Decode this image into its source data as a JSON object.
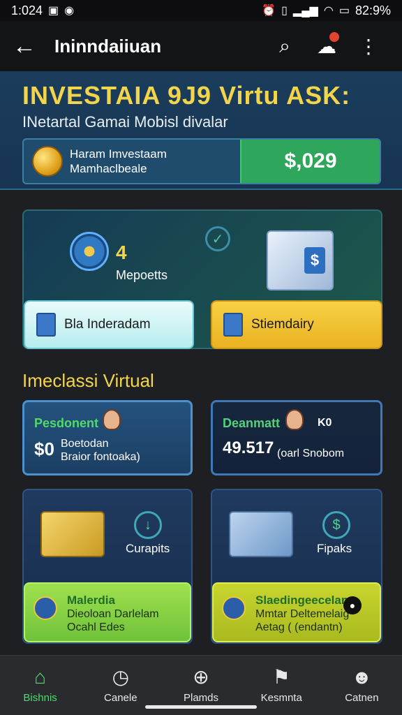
{
  "status": {
    "time": "1:024",
    "battery": "82:9%"
  },
  "app_bar": {
    "title": "Ininndaiiuan"
  },
  "hero": {
    "title": "INVESTAIA 9J9 Virtu ASK:",
    "subtitle": "INetartal Gamai Mobisl divalar",
    "card_line1": "Haram Imvestaam",
    "card_line2": "Mamhaclbeale",
    "card_value": "$,029"
  },
  "panel": {
    "number": "4",
    "label": "Mepoetts",
    "button_left": "Bla Inderadam",
    "button_right": "Stiemdairy"
  },
  "section": {
    "title": "Imeclassi Virtual"
  },
  "cards": [
    {
      "head": "Pesdonent",
      "big": "$0",
      "line1": "Boetodan",
      "line2": "Braior fontoaka)"
    },
    {
      "head": "Deanmatt",
      "extra": "K0",
      "big": "49.517",
      "line1": "(oarl Snobom"
    }
  ],
  "tiles": [
    {
      "label": "Curapits",
      "foot_head": "Malerdia",
      "foot_line1": "Dieoloan Darlelam",
      "foot_line2": "Ocahl Edes"
    },
    {
      "label": "Fipaks",
      "foot_head": "Slaedingeecelam",
      "foot_line1": "Mmtar Deltemelaig",
      "foot_line2": "Aetag ( (endantn)"
    }
  ],
  "nav": [
    {
      "label": "Bishnis",
      "icon": "home-icon"
    },
    {
      "label": "Canele",
      "icon": "clock-icon"
    },
    {
      "label": "Plamds",
      "icon": "grid-icon"
    },
    {
      "label": "Kesmnta",
      "icon": "bookmark-icon"
    },
    {
      "label": "Catnen",
      "icon": "person-icon"
    }
  ],
  "colors": {
    "accent_gold": "#f2d54a",
    "accent_green": "#4fdb6a",
    "value_green": "#2ea75c"
  }
}
